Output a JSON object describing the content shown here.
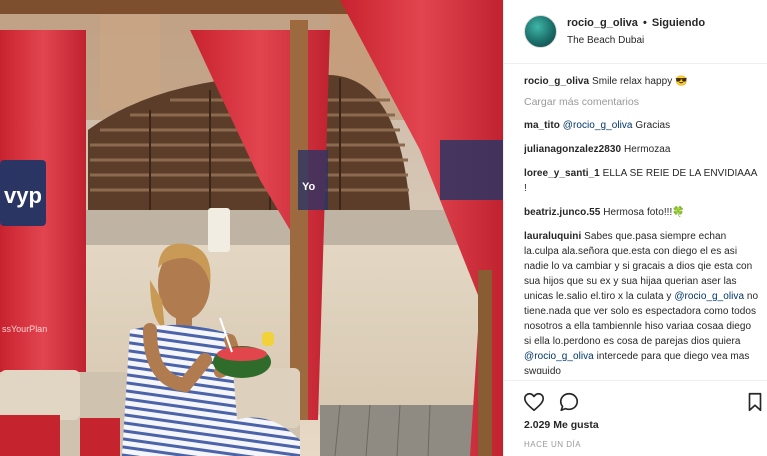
{
  "post": {
    "brand_text": "vyp",
    "banner_text": "ssYourPlan",
    "banner_text_2": "Yo"
  },
  "header": {
    "username": "rocio_g_oliva",
    "separator": "•",
    "follow_status": "Siguiendo",
    "location": "The Beach Dubai"
  },
  "caption": {
    "username": "rocio_g_oliva",
    "text": "Smile relax happy 😎"
  },
  "load_more": "Cargar más comentarios",
  "comments": [
    {
      "username": "ma_tito",
      "mention": "@rocio_g_oliva",
      "text": " Gracias"
    },
    {
      "username": "julianagonzalez2830",
      "text": "Hermozaa"
    },
    {
      "username": "loree_y_santi_1",
      "text": "ELLA SE REIE DE LA ENVIDIAAA !"
    },
    {
      "username": "beatriz.junco.55",
      "text": "Hermosa foto!!!🍀"
    },
    {
      "username": "lauraluquini",
      "text_a": "Sabes que.pasa siempre echan la.culpa ala.señora que.esta con diego el es asi nadie lo va cambiar y si gracais a dios qie esta con sua hijos que su ex y sua hijaa querian aser las unicas le.salio el.tiro x la culata y ",
      "mention_a": "@rocio_g_oliva",
      "text_b": " no tiene.nada que ver solo es espectadora como todos nosotros a ella tambiennle hiso variaa cosaa diego si ella lo.perdono es cosa de parejas dios quiera ",
      "mention_b": "@rocio_g_oliva",
      "text_c": " intercede para que diego vea mas swguido"
    }
  ],
  "actions": {
    "icons": [
      "heart-icon",
      "comment-icon",
      "bookmark-icon"
    ],
    "likes": "2.029 Me gusta",
    "timestamp": "HACE UN DÍA"
  },
  "colors": {
    "brand_red": "#d8303d",
    "mention_blue": "#003569",
    "muted_gray": "#999999"
  }
}
